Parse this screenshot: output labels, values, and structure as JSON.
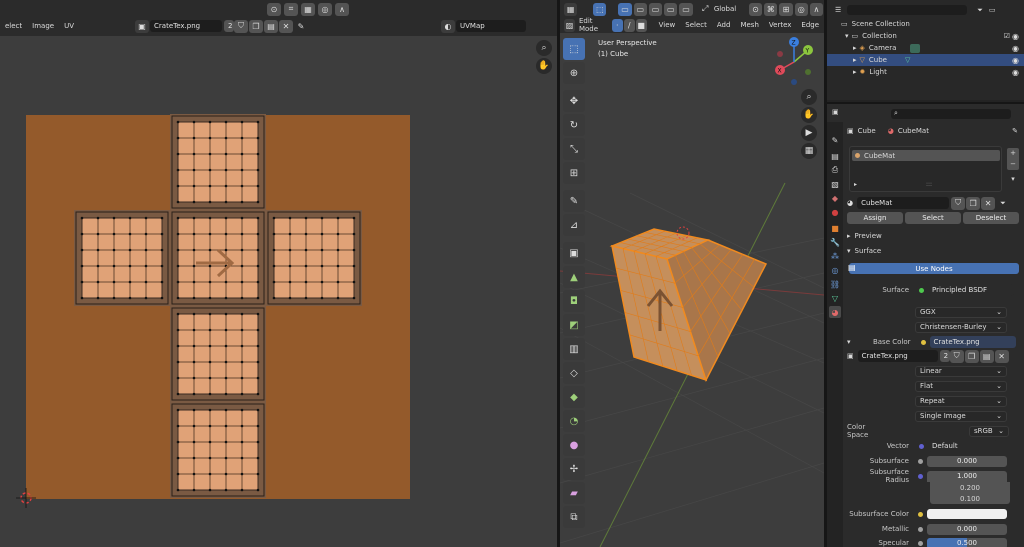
{
  "uv_editor": {
    "menus": [
      "elect",
      "Image",
      "UV"
    ],
    "image_name": "CrateTex.png",
    "image_users": "2",
    "uvmap_name": "UVMap",
    "colors": {
      "texture_bg": "#945a2b",
      "island": "#e0a277",
      "island_line": "#7a5a43",
      "grid_vertex": "#111111"
    }
  },
  "viewport": {
    "mode": "Edit Mode",
    "orientation": "Global",
    "menus": [
      "View",
      "Select",
      "Add",
      "Mesh",
      "Vertex",
      "Edge"
    ],
    "view_name": "User Perspective",
    "object_label": "(1) Cube",
    "axes": [
      "Y",
      "X",
      "Z"
    ],
    "colors": {
      "cube_face": "#c58f5c",
      "selection": "#f08a1f",
      "grid": "#474747"
    }
  },
  "outliner": {
    "root": "Scene Collection",
    "collection": "Collection",
    "items": [
      {
        "name": "Camera",
        "selected": false
      },
      {
        "name": "Cube",
        "selected": true
      },
      {
        "name": "Light",
        "selected": false
      }
    ]
  },
  "properties": {
    "breadcrumb_object": "Cube",
    "breadcrumb_material": "CubeMat",
    "slot_name": "CubeMat",
    "material_name": "CubeMat",
    "assign": "Assign",
    "select": "Select",
    "deselect": "Deselect",
    "preview": "Preview",
    "surface": "Surface",
    "use_nodes": "Use Nodes",
    "surface_label": "Surface",
    "surface_value": "Principled BSDF",
    "distribution": "GGX",
    "subsurface_method": "Christensen-Burley",
    "base_color_label": "Base Color",
    "base_color_value": "CrateTex.png",
    "image_name": "CrateTex.png",
    "image_users": "2",
    "interpolation": "Linear",
    "projection": "Flat",
    "extension": "Repeat",
    "source": "Single Image",
    "color_space_label": "Color Space",
    "color_space_value": "sRGB",
    "vector_label": "Vector",
    "vector_value": "Default",
    "subsurface_label": "Subsurface",
    "subsurface_value": "0.000",
    "subsurface_radius_label": "Subsurface Radius",
    "subsurface_radius": [
      "1.000",
      "0.200",
      "0.100"
    ],
    "subsurface_color_label": "Subsurface Color",
    "metallic_label": "Metallic",
    "metallic_value": "0.000",
    "specular_label": "Specular",
    "specular_value": "0.500",
    "specular_fill": 0.5
  }
}
